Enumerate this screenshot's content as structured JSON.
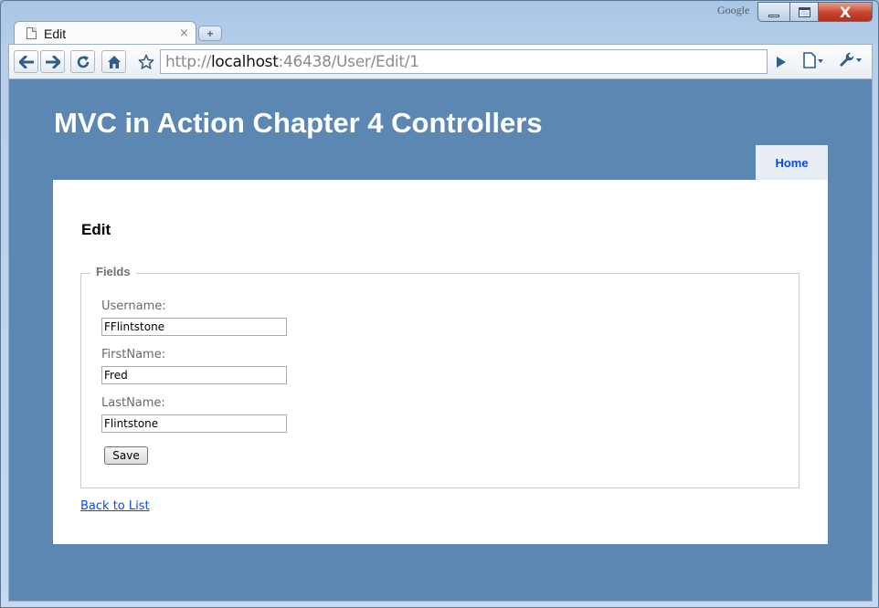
{
  "window": {
    "corner_label": "Google",
    "close_glyph": "X"
  },
  "tab": {
    "title": "Edit",
    "close_glyph": "×",
    "new_tab_glyph": "+"
  },
  "address_bar": {
    "url_prefix": "http://",
    "url_host": "localhost",
    "url_rest": ":46438/User/Edit/1"
  },
  "icons": {
    "back": "back-arrow-icon",
    "forward": "forward-arrow-icon",
    "reload": "reload-icon",
    "home": "home-icon",
    "bookmark": "star-icon",
    "go": "play-icon",
    "page_menu": "page-icon",
    "tools_menu": "wrench-icon"
  },
  "site": {
    "title": "MVC in Action Chapter 4 Controllers",
    "menu": [
      {
        "label": "Home"
      }
    ]
  },
  "page": {
    "heading": "Edit",
    "legend": "Fields",
    "fields": [
      {
        "label": "Username:",
        "value": "FFlintstone"
      },
      {
        "label": "FirstName:",
        "value": "Fred"
      },
      {
        "label": "LastName:",
        "value": "Flintstone"
      }
    ],
    "save_label": "Save",
    "back_link": "Back to List"
  },
  "colors": {
    "page_background": "#5c87b2",
    "link": "#034af3",
    "content_background": "#ffffff"
  }
}
